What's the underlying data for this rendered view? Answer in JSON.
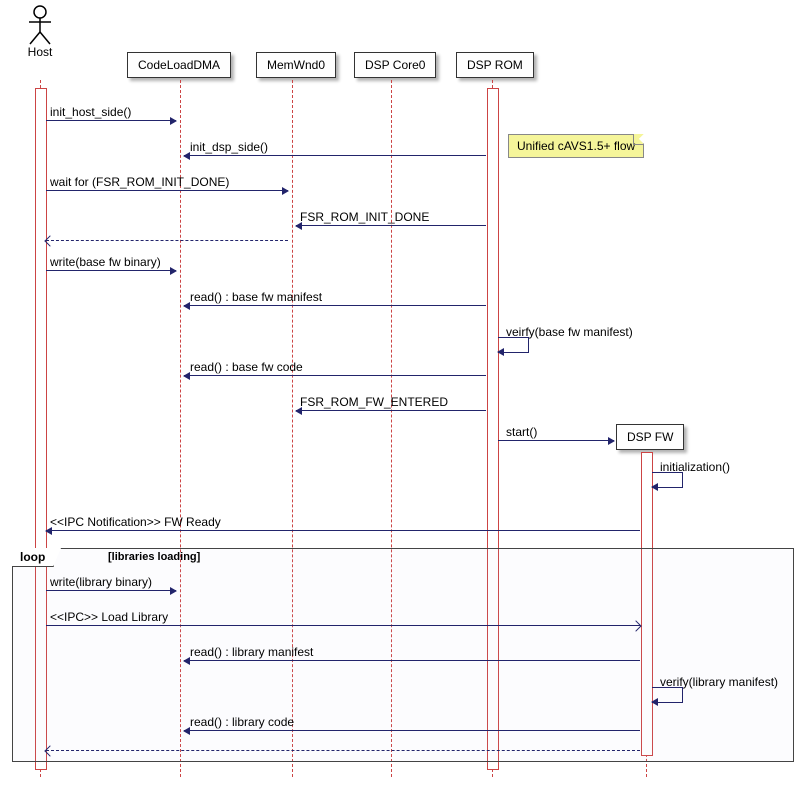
{
  "actors": {
    "host": "Host",
    "codeloaddma": "CodeLoadDMA",
    "memwnd0": "MemWnd0",
    "dspcore0": "DSP Core0",
    "dsprom": "DSP ROM",
    "dspfw": "DSP FW"
  },
  "note": "Unified cAVS1.5+ flow",
  "loop": {
    "keyword": "loop",
    "title": "[libraries loading]"
  },
  "msgs": {
    "m1": "init_host_side()",
    "m2": "init_dsp_side()",
    "m3": "wait for (FSR_ROM_INIT_DONE)",
    "m4": "FSR_ROM_INIT_DONE",
    "m5": "write(base fw binary)",
    "m6": "read() : base fw manifest",
    "m7": "veirfy(base fw manifest)",
    "m8": "read() : base fw code",
    "m9": "FSR_ROM_FW_ENTERED",
    "m10": "start()",
    "m11": "initialization()",
    "m12": "<<IPC Notification>> FW Ready",
    "m13": "write(library binary)",
    "m14": "<<IPC>> Load Library",
    "m15": "read() : library manifest",
    "m16": "verify(library manifest)",
    "m17": "read() : library code"
  }
}
